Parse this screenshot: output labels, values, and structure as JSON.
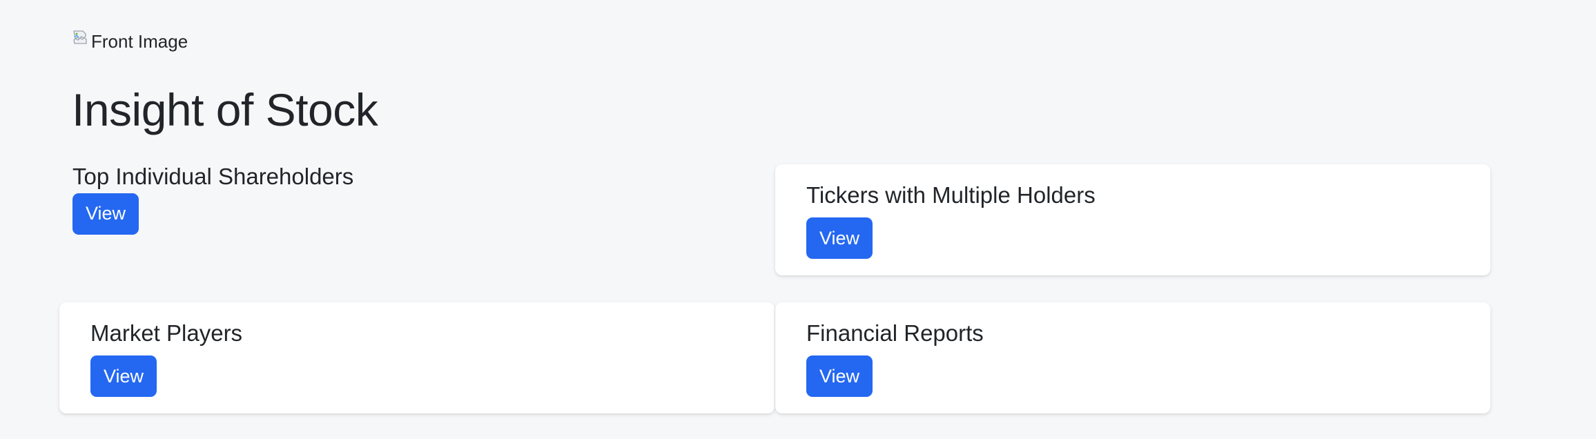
{
  "header": {
    "image_alt": "Front Image",
    "title": "Insight of Stock"
  },
  "sections": [
    {
      "title": "Top Individual Shareholders",
      "button_label": "View"
    },
    {
      "title": "Tickers with Multiple Holders",
      "button_label": "View"
    },
    {
      "title": "Market Players",
      "button_label": "View"
    },
    {
      "title": "Financial Reports",
      "button_label": "View"
    }
  ],
  "colors": {
    "page_background": "#f6f7f9",
    "button_primary": "#2468f2",
    "card_background": "#ffffff",
    "text": "#212529"
  },
  "icons": {
    "front_image": "broken-image-icon"
  }
}
